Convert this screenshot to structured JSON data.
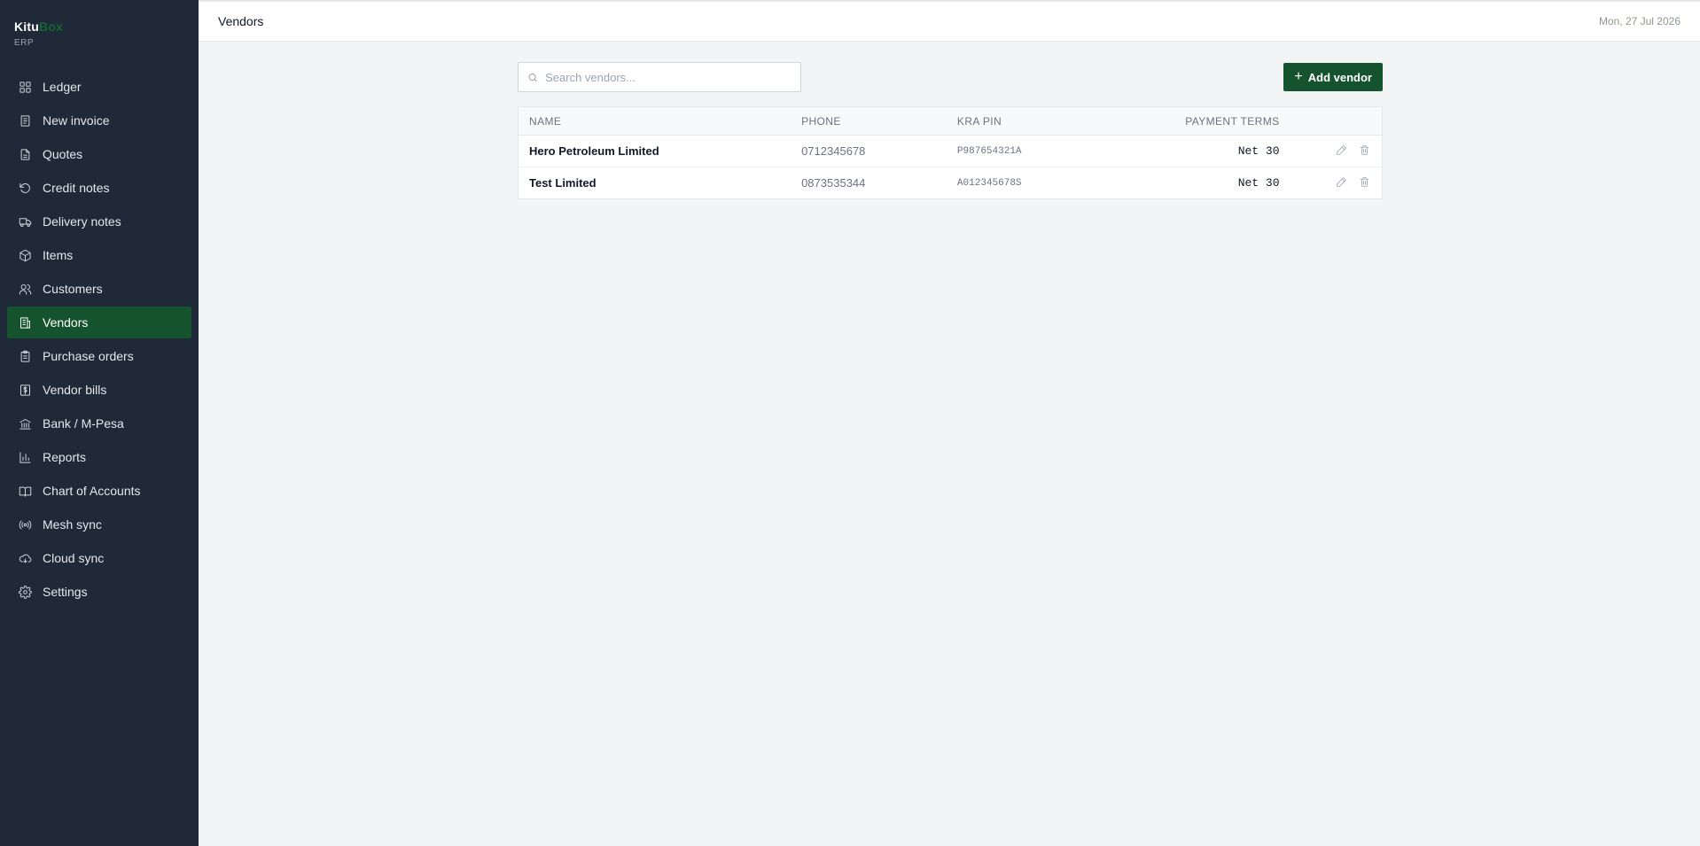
{
  "brand": {
    "name_primary": "Kitu",
    "name_accent": "Box",
    "subtitle": "ERP",
    "accent_color": "#166534"
  },
  "sidebar": {
    "items": [
      {
        "label": "Ledger",
        "icon": "grid-icon",
        "active": false
      },
      {
        "label": "New invoice",
        "icon": "document-icon",
        "active": false
      },
      {
        "label": "Quotes",
        "icon": "file-text-icon",
        "active": false
      },
      {
        "label": "Credit notes",
        "icon": "rotate-ccw-icon",
        "active": false
      },
      {
        "label": "Delivery notes",
        "icon": "truck-icon",
        "active": false
      },
      {
        "label": "Items",
        "icon": "package-icon",
        "active": false
      },
      {
        "label": "Customers",
        "icon": "users-icon",
        "active": false
      },
      {
        "label": "Vendors",
        "icon": "building-icon",
        "active": true
      },
      {
        "label": "Purchase orders",
        "icon": "clipboard-icon",
        "active": false
      },
      {
        "label": "Vendor bills",
        "icon": "bill-icon",
        "active": false
      },
      {
        "label": "Bank / M-Pesa",
        "icon": "bank-icon",
        "active": false
      },
      {
        "label": "Reports",
        "icon": "bar-chart-icon",
        "active": false
      },
      {
        "label": "Chart of Accounts",
        "icon": "book-icon",
        "active": false
      },
      {
        "label": "Mesh sync",
        "icon": "radio-icon",
        "active": false
      },
      {
        "label": "Cloud sync",
        "icon": "cloud-sync-icon",
        "active": false
      },
      {
        "label": "Settings",
        "icon": "gear-icon",
        "active": false
      }
    ],
    "active_color": "#14532d",
    "background": "#1f2937"
  },
  "header": {
    "title": "Vendors",
    "date": "Mon, 27 Jul 2026"
  },
  "toolbar": {
    "search_placeholder": "Search vendors...",
    "add_label": "Add vendor"
  },
  "table": {
    "columns": {
      "name": "NAME",
      "phone": "PHONE",
      "kra_pin": "KRA PIN",
      "payment_terms": "PAYMENT TERMS"
    },
    "rows": [
      {
        "name": "Hero Petroleum Limited",
        "phone": "0712345678",
        "kra_pin": "P987654321A",
        "payment_terms": "Net 30"
      },
      {
        "name": "Test Limited",
        "phone": "0873535344",
        "kra_pin": "A012345678S",
        "payment_terms": "Net 30"
      }
    ]
  }
}
